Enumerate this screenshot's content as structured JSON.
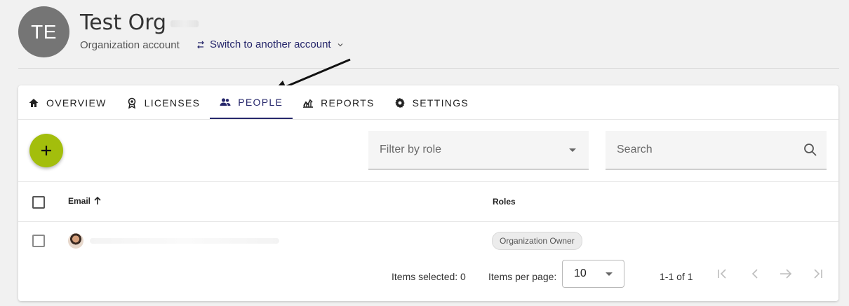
{
  "header": {
    "avatar_initials": "TE",
    "org_name": "Test Org",
    "account_type": "Organization account",
    "switch_account_label": "Switch to another account"
  },
  "tabs": [
    {
      "label": "OVERVIEW",
      "icon": "home-icon",
      "active": false
    },
    {
      "label": "LICENSES",
      "icon": "badge-icon",
      "active": false
    },
    {
      "label": "PEOPLE",
      "icon": "people-icon",
      "active": true
    },
    {
      "label": "REPORTS",
      "icon": "chart-icon",
      "active": false
    },
    {
      "label": "SETTINGS",
      "icon": "gear-icon",
      "active": false
    }
  ],
  "toolbar": {
    "add_button_icon": "plus-icon",
    "filter_placeholder": "Filter by role",
    "search_placeholder": "Search"
  },
  "table": {
    "columns": {
      "email": "Email",
      "roles": "Roles"
    },
    "rows": [
      {
        "email": "",
        "role": "Organization Owner"
      }
    ]
  },
  "footer": {
    "items_selected": "Items selected: 0",
    "items_per_page_label": "Items per page:",
    "page_size": "10",
    "range": "1-1 of 1"
  },
  "colors": {
    "accent": "#26276b",
    "fab": "#a3be0c",
    "avatar": "#757575"
  }
}
